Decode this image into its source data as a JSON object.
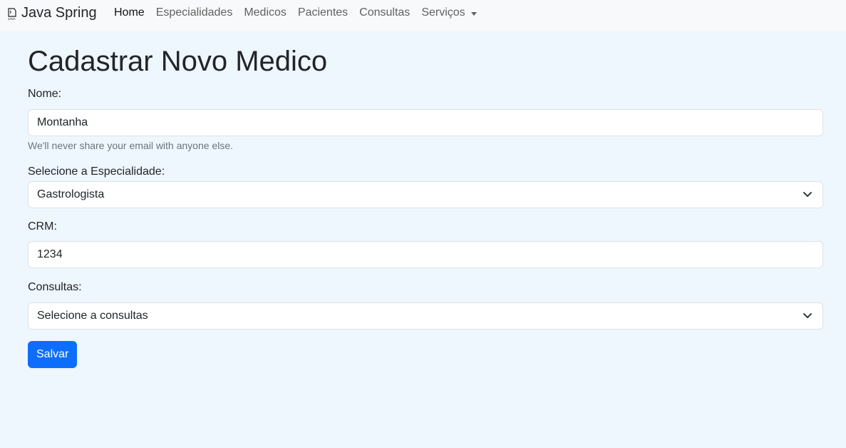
{
  "navbar": {
    "brand": {
      "icon": "java-icon",
      "label": "Java Spring"
    },
    "links": [
      {
        "label": "Home",
        "active": true
      },
      {
        "label": "Especialidades",
        "active": false
      },
      {
        "label": "Medicos",
        "active": false
      },
      {
        "label": "Pacientes",
        "active": false
      },
      {
        "label": "Consultas",
        "active": false
      },
      {
        "label": "Serviços",
        "active": false,
        "dropdown": true
      }
    ]
  },
  "page": {
    "title": "Cadastrar Novo Medico"
  },
  "form": {
    "nome": {
      "label": "Nome:",
      "value": "Montanha",
      "help": "We'll never share your email with anyone else."
    },
    "especialidade": {
      "label": "Selecione a Especialidade:",
      "selected": "Gastrologista"
    },
    "crm": {
      "label": "CRM:",
      "value": "1234"
    },
    "consultas": {
      "label": "Consultas:",
      "selected": "Selecione a consultas"
    },
    "submit_label": "Salvar"
  },
  "colors": {
    "page_background": "#eef6fe",
    "navbar_background": "#f8f9fa",
    "primary": "#0d6efd"
  }
}
